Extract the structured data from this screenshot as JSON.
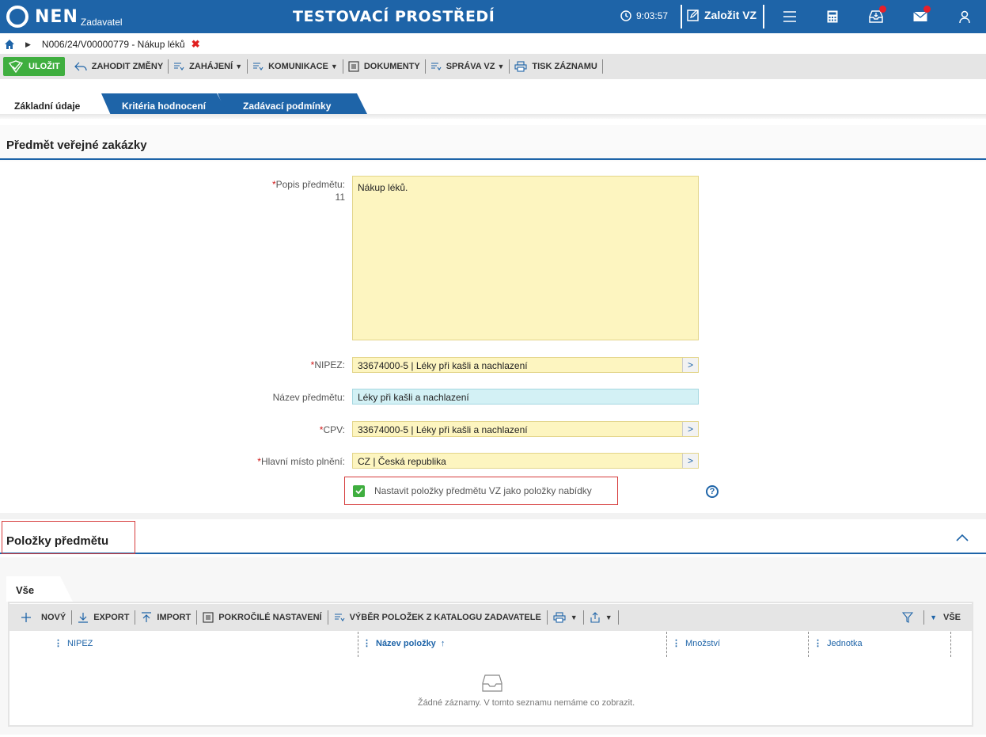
{
  "app": {
    "logo_text": "NEN",
    "logo_sub": "Zadavatel",
    "environment": "TESTOVACÍ PROSTŘEDÍ",
    "clock": "9:03:57",
    "new_vz": "Založit VZ",
    "icons": [
      "menu-icon",
      "calculator-icon",
      "inbox-icon",
      "mail-icon",
      "user-icon"
    ]
  },
  "breadcrumb": {
    "text": "N006/24/V00000779 - Nákup léků"
  },
  "toolbar": {
    "save": "ULOŽIT",
    "discard": "ZAHODIT ZMĚNY",
    "start": "ZAHÁJENÍ",
    "communication": "KOMUNIKACE",
    "documents": "DOKUMENTY",
    "management": "SPRÁVA VZ",
    "print": "TISK ZÁZNAMU"
  },
  "tabs": [
    {
      "label": "Základní údaje",
      "active": true
    },
    {
      "label": "Kritéria hodnocení",
      "active": false
    },
    {
      "label": "Zadávací podmínky",
      "active": false
    }
  ],
  "subject": {
    "title": "Předmět veřejné zakázky",
    "description_label": "Popis předmětu:",
    "description_count": "11",
    "description_value": "Nákup léků.",
    "nipez_label": "NIPEZ:",
    "nipez_value": "33674000-5 | Léky při kašli a nachlazení",
    "name_label": "Název předmětu:",
    "name_value": "Léky při kašli a nachlazení",
    "cpv_label": "CPV:",
    "cpv_value": "33674000-5 | Léky při kašli a nachlazení",
    "place_label": "Hlavní místo plnění:",
    "place_value": "CZ | Česká republika",
    "checkbox_label": "Nastavit položky předmětu VZ jako položky nabídky",
    "checkbox_checked": true
  },
  "items": {
    "title": "Položky předmětu",
    "subtab": "Vše",
    "toolbar": {
      "new": "NOVÝ",
      "export": "EXPORT",
      "import": "IMPORT",
      "advanced": "POKROČILÉ NASTAVENÍ",
      "catalog": "VÝBĚR POLOŽEK Z KATALOGU ZADAVATELE",
      "filter_all": "VŠE"
    },
    "columns": [
      "NIPEZ",
      "Název položky",
      "Množství",
      "Jednotka"
    ],
    "sort_indicator": "↑",
    "empty_text": "Žádné záznamy. V tomto seznamu nemáme co zobrazit."
  },
  "colors": {
    "brand_blue": "#1e64a8",
    "save_green": "#3fae3f",
    "field_yellow": "#fdf5c0",
    "field_cyan": "#d3f1f5",
    "highlight_red": "#d63b3b"
  }
}
